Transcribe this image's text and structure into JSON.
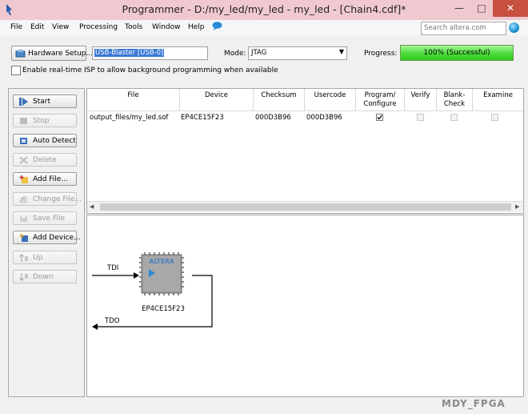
{
  "window": {
    "title": "Programmer - D:/my_led/my_led - my_led - [Chain4.cdf]*",
    "minimize": "—",
    "maximize": "□",
    "close": "✕"
  },
  "menu": [
    "File",
    "Edit",
    "View",
    "Processing",
    "Tools",
    "Window",
    "Help"
  ],
  "search": {
    "placeholder": "Search altera.com"
  },
  "toolbar": {
    "hardware_setup": "Hardware Setup...",
    "hardware_value": "USB-Blaster [USB-0]",
    "mode_label": "Mode:",
    "mode_value": "JTAG",
    "progress_label": "Progress:",
    "progress_text": "100% (Successful)",
    "progress_fraction": 1.0,
    "progress_color": "#4cdc3b",
    "isp_label": "Enable real-time ISP to allow background programming when available"
  },
  "sidebar": [
    {
      "label": "Start",
      "icon": "start-icon",
      "enabled": true
    },
    {
      "label": "Stop",
      "icon": "stop-icon",
      "enabled": false
    },
    {
      "label": "Auto Detect",
      "icon": "auto-detect-icon",
      "enabled": true
    },
    {
      "label": "Delete",
      "icon": "delete-icon",
      "enabled": false
    },
    {
      "label": "Add File...",
      "icon": "add-file-icon",
      "enabled": true
    },
    {
      "label": "Change File...",
      "icon": "change-file-icon",
      "enabled": false
    },
    {
      "label": "Save File",
      "icon": "save-file-icon",
      "enabled": false
    },
    {
      "label": "Add Device...",
      "icon": "add-device-icon",
      "enabled": true
    },
    {
      "label": "Up",
      "icon": "up-icon",
      "enabled": false
    },
    {
      "label": "Down",
      "icon": "down-icon",
      "enabled": false
    }
  ],
  "table": {
    "headers": [
      "File",
      "Device",
      "Checksum",
      "Usercode",
      "Program/\nConfigure",
      "Verify",
      "Blank-\nCheck",
      "Examine"
    ],
    "rows": [
      {
        "file": "output_files/my_led.sof",
        "device": "EP4CE15F23",
        "checksum": "000D3B96",
        "usercode": "000D3B96",
        "program": true,
        "verify": false,
        "blank_check": false,
        "examine": false
      }
    ]
  },
  "chain": {
    "chip_label": "EP4CE15F23",
    "chip_logo": "ALTERA",
    "tdi": "TDI",
    "tdo": "TDO"
  },
  "watermark": "MDY_FPGA"
}
